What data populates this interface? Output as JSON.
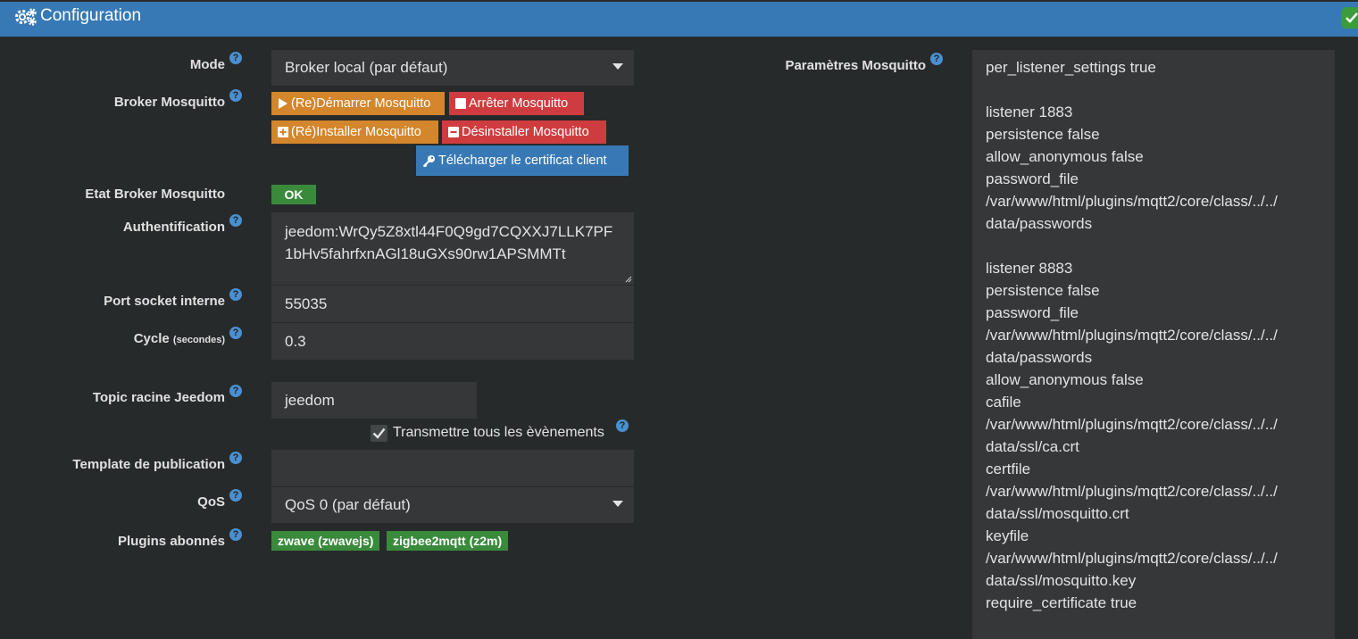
{
  "header": {
    "title": "Configuration"
  },
  "labels": {
    "mode": "Mode",
    "broker": "Broker Mosquitto",
    "broker_state": "Etat Broker Mosquitto",
    "auth": "Authentification",
    "port": "Port socket interne",
    "cycle": "Cycle",
    "cycle_unit": "(secondes)",
    "topic": "Topic racine Jeedom",
    "template": "Template de publication",
    "qos": "QoS",
    "plugins": "Plugins abonnés",
    "mosquitto_params": "Paramètres Mosquitto"
  },
  "help_icon": "?",
  "fields": {
    "mode": "Broker local (par défaut)",
    "auth": "jeedom:WrQy5Z8xtl44F0Q9gd7CQXXJ7LLK7PF1bHv5fahrfxnAGl18uGXs90rw1APSMMTt",
    "port": "55035",
    "cycle": "0.3",
    "topic": "jeedom",
    "template": "",
    "qos": "QoS 0 (par défaut)"
  },
  "buttons": {
    "restart": "(Re)Démarrer Mosquitto",
    "stop": "Arrêter Mosquitto",
    "install": "(Ré)Installer Mosquitto",
    "uninstall": "Désinstaller Mosquitto",
    "download_cert": "Télécharger le certificat client"
  },
  "broker_state": "OK",
  "checkbox_label": "Transmettre tous les èvènements",
  "plugins": [
    "zwave (zwavejs)",
    "zigbee2mqtt (z2m)"
  ],
  "mosquitto_params": "per_listener_settings true\n\nlistener 1883\npersistence false\nallow_anonymous false\npassword_file\n/var/www/html/plugins/mqtt2/core/class/../../\ndata/passwords\n\nlistener 8883\npersistence false\npassword_file\n/var/www/html/plugins/mqtt2/core/class/../../\ndata/passwords\nallow_anonymous false\ncafile\n/var/www/html/plugins/mqtt2/core/class/../../\ndata/ssl/ca.crt\ncertfile\n/var/www/html/plugins/mqtt2/core/class/../../\ndata/ssl/mosquitto.crt\nkeyfile\n/var/www/html/plugins/mqtt2/core/class/../../\ndata/ssl/mosquitto.key\nrequire_certificate true",
  "colors": {
    "header": "#3679b5",
    "background": "#272a2b",
    "field": "#353739",
    "warning": "#d3862b",
    "danger": "#cf3c3f",
    "primary": "#3879b5",
    "success": "#3a8a3c"
  }
}
